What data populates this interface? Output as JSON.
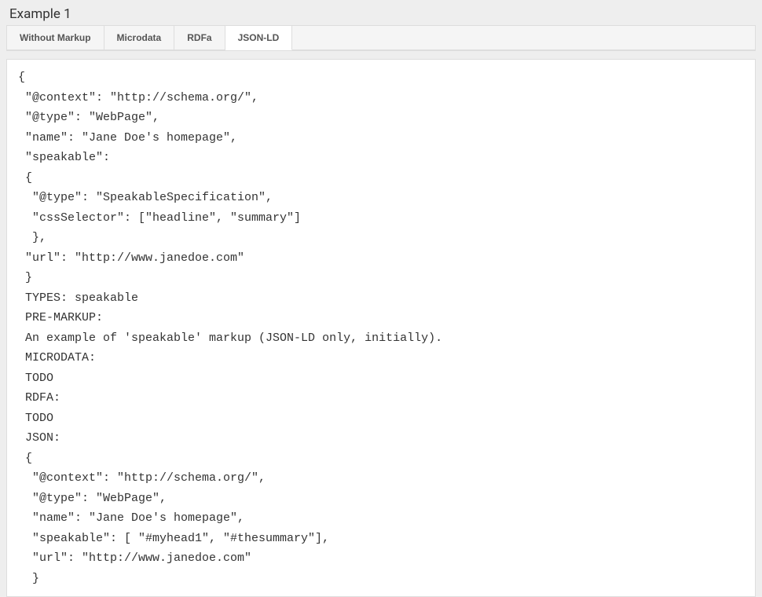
{
  "heading": "Example 1",
  "tabs": [
    {
      "label": "Without Markup",
      "active": false
    },
    {
      "label": "Microdata",
      "active": false
    },
    {
      "label": "RDFa",
      "active": false
    },
    {
      "label": "JSON-LD",
      "active": true
    }
  ],
  "code": "{\n \"@context\": \"http://schema.org/\",\n \"@type\": \"WebPage\",\n \"name\": \"Jane Doe's homepage\",\n \"speakable\":\n {\n  \"@type\": \"SpeakableSpecification\",\n  \"cssSelector\": [\"headline\", \"summary\"]\n  },\n \"url\": \"http://www.janedoe.com\"\n }\n TYPES: speakable\n PRE-MARKUP:\n An example of 'speakable' markup (JSON-LD only, initially).\n MICRODATA:\n TODO\n RDFA:\n TODO\n JSON:\n {\n  \"@context\": \"http://schema.org/\",\n  \"@type\": \"WebPage\",\n  \"name\": \"Jane Doe's homepage\",\n  \"speakable\": [ \"#myhead1\", \"#thesummary\"],\n  \"url\": \"http://www.janedoe.com\"\n  }"
}
